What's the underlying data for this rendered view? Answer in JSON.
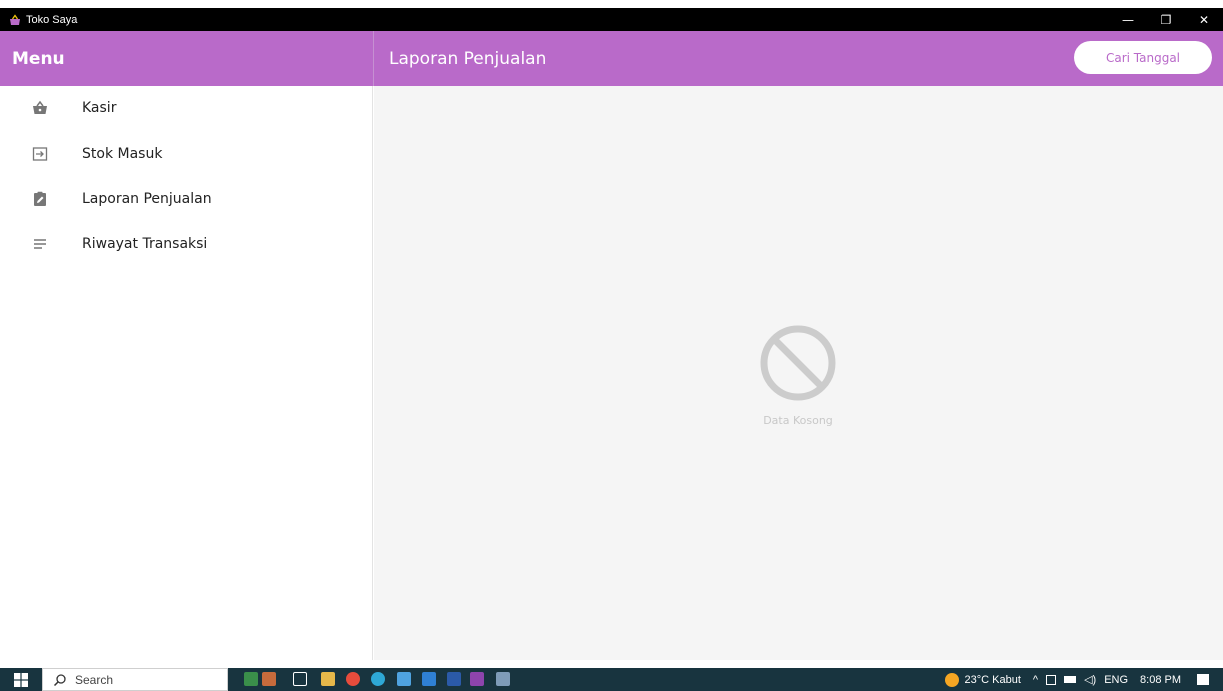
{
  "window": {
    "title": "Toko Saya",
    "minimize_glyph": "—",
    "restore_glyph": "❐",
    "close_glyph": "✕"
  },
  "sidebar": {
    "header": "Menu",
    "items": [
      {
        "label": "Kasir",
        "icon": "basket-icon"
      },
      {
        "label": "Stok Masuk",
        "icon": "login-arrow-icon"
      },
      {
        "label": "Laporan Penjualan",
        "icon": "clipboard-edit-icon"
      },
      {
        "label": "Riwayat Transaksi",
        "icon": "list-lines-icon"
      }
    ]
  },
  "main": {
    "title": "Laporan Penjualan",
    "search_date_label": "Cari Tanggal",
    "empty_text": "Data Kosong"
  },
  "taskbar": {
    "search_label": "Search",
    "weather": "23°C Kabut",
    "language": "ENG",
    "time": "8:08 PM"
  },
  "colors": {
    "accent": "#b96ac9",
    "titlebar": "#000000",
    "taskbar": "#18343f"
  }
}
